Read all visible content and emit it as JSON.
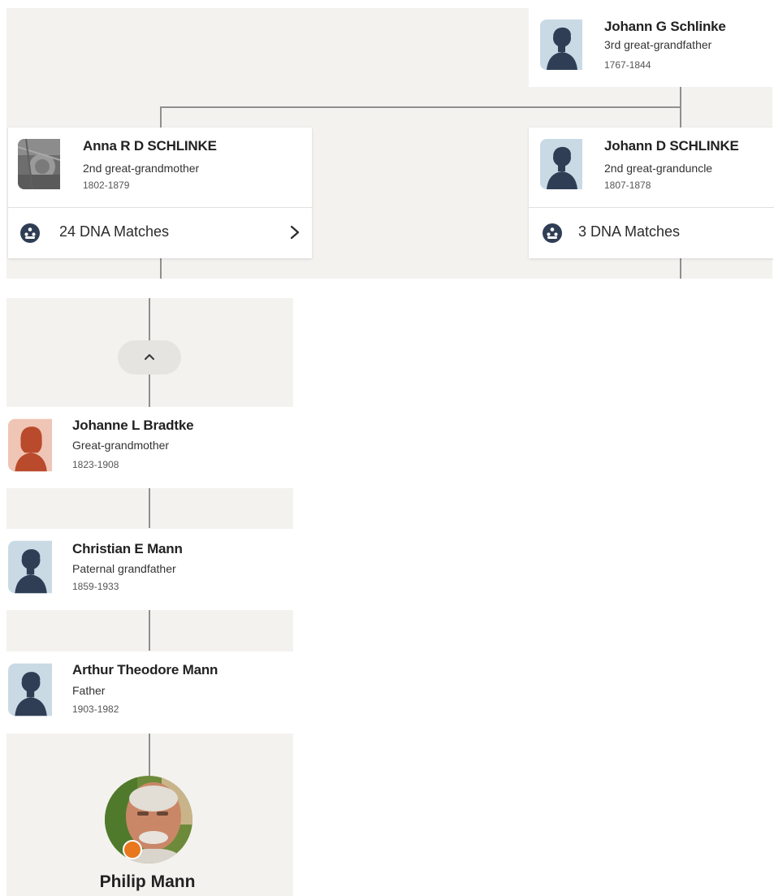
{
  "colors": {
    "canvas": "#f4f2ef",
    "card": "#ffffff",
    "connector": "#8f8f8f",
    "male_avatar_bg": "#c9dae5",
    "male_avatar_fg": "#2f3e55",
    "female_avatar_bg": "#efc5b5",
    "female_avatar_fg": "#b94a2c",
    "dna_icon": "#2f3e55",
    "home_badge": "#e8771d"
  },
  "ancestor": {
    "name": "Johann G Schlinke",
    "relationship": "3rd great-grandfather",
    "dates": "1767-1844",
    "avatar_icon": "male-silhouette-icon"
  },
  "left_branch": {
    "name": "Anna R D SCHLINKE",
    "relationship": "2nd great-grandmother",
    "dates": "1802-1879",
    "avatar_icon": "photo-thumbnail",
    "dna_matches": "24 DNA Matches",
    "dna_icon": "dna-matches-icon",
    "chevron_icon": "chevron-right-icon"
  },
  "right_branch": {
    "name": "Johann D SCHLINKE",
    "relationship": "2nd great-granduncle",
    "dates": "1807-1878",
    "avatar_icon": "male-silhouette-icon",
    "dna_matches": "3 DNA Matches",
    "dna_icon": "dna-matches-icon"
  },
  "collapse_icon": "chevron-up-icon",
  "lineage": [
    {
      "name": "Johanne L Bradtke",
      "relationship": "Great-grandmother",
      "dates": "1823-1908",
      "avatar_icon": "female-silhouette-icon"
    },
    {
      "name": "Christian E Mann",
      "relationship": "Paternal grandfather",
      "dates": "1859-1933",
      "avatar_icon": "male-silhouette-icon"
    },
    {
      "name": "Arthur Theodore Mann",
      "relationship": "Father",
      "dates": "1903-1982",
      "avatar_icon": "male-silhouette-icon"
    }
  ],
  "home_person": {
    "name": "Philip Mann",
    "avatar_icon": "profile-photo",
    "badge_icon": "home-person-badge-icon"
  }
}
